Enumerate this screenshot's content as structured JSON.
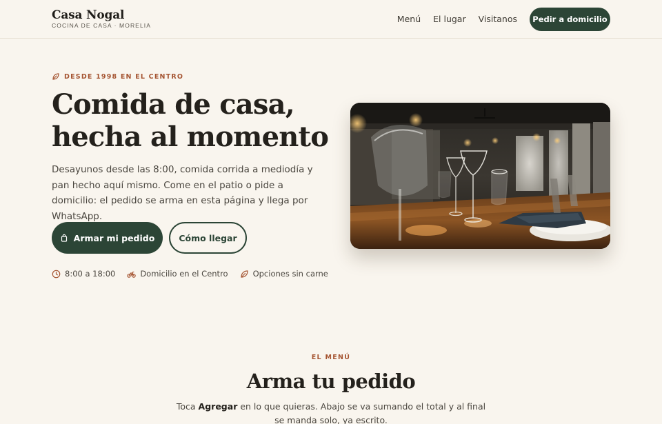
{
  "header": {
    "brand_name": "Casa Nogal",
    "brand_tagline": "COCINA DE CASA · MORELIA",
    "nav": [
      "Menú",
      "El lugar",
      "Visitanos"
    ],
    "cta_label": "Pedir a domicilio"
  },
  "hero": {
    "eyebrow": "DESDE 1998 EN EL CENTRO",
    "title_line1": "Comida de casa,",
    "title_line2": "hecha al momento",
    "description": "Desayunos desde las 8:00, comida corrida a mediodía y pan hecho aquí mismo. Come en el patio o pide a domicilio: el pedido se arma en esta página y llega por WhatsApp.",
    "primary_button": "Armar mi pedido",
    "secondary_button": "Cómo llegar",
    "facts": [
      {
        "label": "8:00 a 18:00",
        "icon": "clock-icon"
      },
      {
        "label": "Domicilio en el Centro",
        "icon": "bike-icon"
      },
      {
        "label": "Opciones sin carne",
        "icon": "leaf-icon"
      }
    ]
  },
  "menu": {
    "eyebrow": "EL MENÚ",
    "title": "Arma tu pedido",
    "desc_before": "Toca ",
    "desc_bold": "Agregar",
    "desc_after": " en lo que quieras. Abajo se va sumando el total y al final se manda solo, ya escrito."
  },
  "colors": {
    "background": "#f9f5ee",
    "primary": "#2c4536",
    "accent": "#a55431",
    "text": "#24211c"
  }
}
